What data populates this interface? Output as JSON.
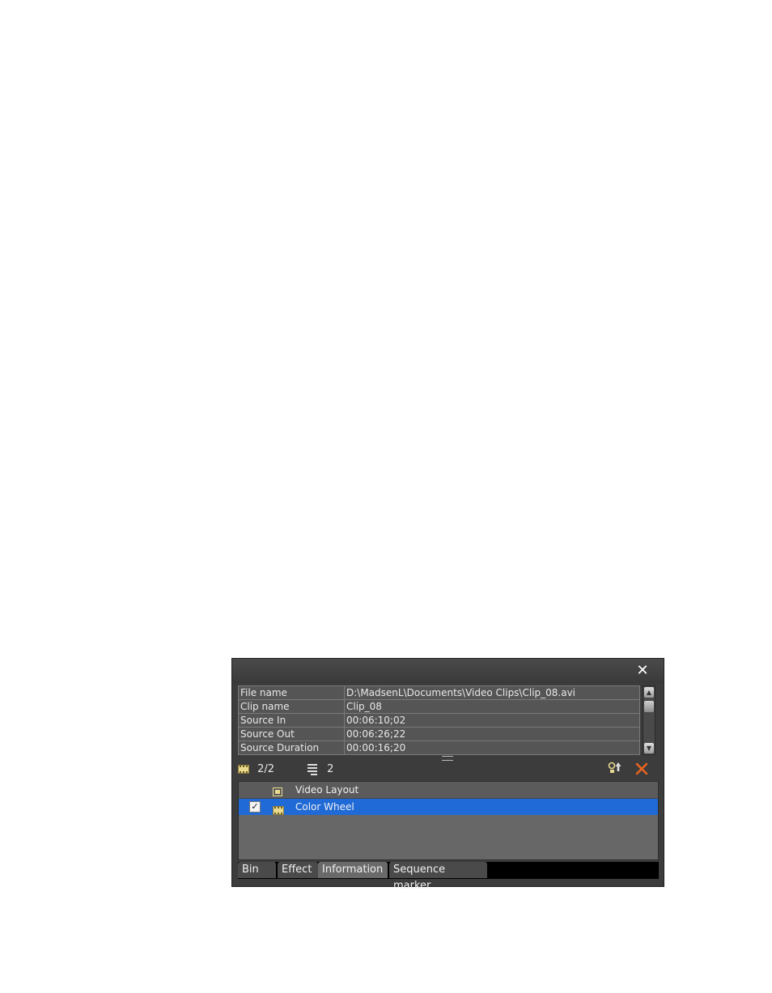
{
  "panel": {
    "close_label": "✕"
  },
  "info": {
    "rows": [
      {
        "key": "File name",
        "value": "D:\\MadsenL\\Documents\\Video Clips\\Clip_08.avi"
      },
      {
        "key": "Clip name",
        "value": "Clip_08"
      },
      {
        "key": "Source In",
        "value": "00:06:10;02"
      },
      {
        "key": "Source Out",
        "value": "00:06:26;22"
      },
      {
        "key": "Source Duration",
        "value": "00:00:16;20"
      }
    ]
  },
  "toolbar": {
    "clip_count": "2/2",
    "layer_count": "2"
  },
  "effects": {
    "items": [
      {
        "label": "Video Layout"
      },
      {
        "label": "Color Wheel"
      }
    ]
  },
  "tabs": [
    {
      "label": "Bin"
    },
    {
      "label": "Effect"
    },
    {
      "label": "Information"
    },
    {
      "label": "Sequence marker"
    }
  ],
  "colors": {
    "selection": "#1f6ad6",
    "delete_icon": "#e8641e"
  }
}
